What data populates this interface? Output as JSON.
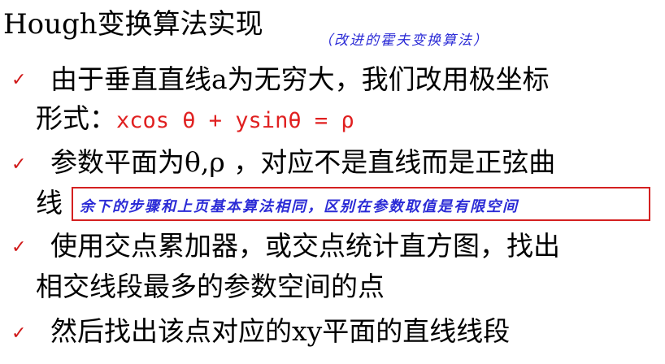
{
  "title": "Hough变换算法实现",
  "title_note": "（改进的霍夫变换算法）",
  "check_mark": "✓",
  "bullets": [
    {
      "line1": "由于垂直直线a为无穷大，我们改用极坐标",
      "line2_prefix": "形式：",
      "formula": "xcos θ + ysinθ = ρ"
    },
    {
      "line1": "参数平面为θ,ρ ，对应不是直线而是正弦曲",
      "line2": "线"
    },
    {
      "line1": "使用交点累加器，或交点统计直方图，找出",
      "line2": "相交线段最多的参数空间的点"
    },
    {
      "line1": "然后找出该点对应的xy平面的直线线段"
    }
  ],
  "boxed_note": "余下的步骤和上页基本算法相同，区别在参数取值是有限空间",
  "colors": {
    "check": "#d01818",
    "formula": "#e02020",
    "handwriting": "#2b2bd6",
    "box_border": "#d42020"
  }
}
